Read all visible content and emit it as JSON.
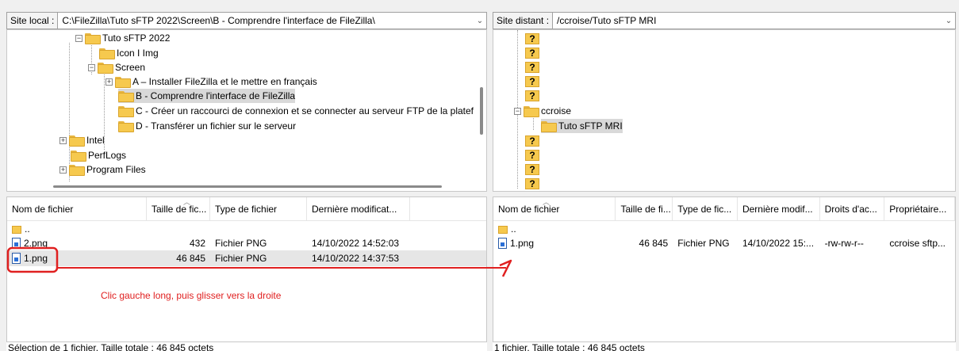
{
  "local": {
    "label": "Site local :",
    "path": "C:\\FileZilla\\Tuto sFTP 2022\\Screen\\B - Comprendre l'interface de FileZilla\\",
    "tree": [
      {
        "label": "Tuto sFTP 2022"
      },
      {
        "label": "Icon I Img"
      },
      {
        "label": "Screen"
      },
      {
        "label": "A – Installer FileZilla et le mettre en français"
      },
      {
        "label": "B - Comprendre l'interface de FileZilla"
      },
      {
        "label": "C - Créer un raccourci de connexion et se connecter au serveur FTP de la platef"
      },
      {
        "label": "D - Transférer un fichier sur le serveur"
      },
      {
        "label": "Intel"
      },
      {
        "label": "PerfLogs"
      },
      {
        "label": "Program Files"
      }
    ],
    "columns": [
      "Nom de fichier",
      "Taille de fic...",
      "Type de fichier",
      "Dernière modificat..."
    ],
    "files": [
      {
        "name": "..",
        "size": "",
        "type": "",
        "modified": ""
      },
      {
        "name": "2.png",
        "size": "432",
        "type": "Fichier PNG",
        "modified": "14/10/2022 14:52:03"
      },
      {
        "name": "1.png",
        "size": "46 845",
        "type": "Fichier PNG",
        "modified": "14/10/2022 14:37:53"
      }
    ],
    "status": "Sélection de 1 fichier. Taille totale : 46 845 octets"
  },
  "remote": {
    "label": "Site distant :",
    "path": "/ccroise/Tuto sFTP MRI",
    "unknown_marker": "?",
    "tree": [
      {
        "label": "ccroise"
      },
      {
        "label": "Tuto sFTP MRI"
      }
    ],
    "columns": [
      "Nom de fichier",
      "Taille de fi...",
      "Type de fic...",
      "Dernière modif...",
      "Droits d'ac...",
      "Propriétaire..."
    ],
    "files": [
      {
        "name": "..",
        "size": "",
        "type": "",
        "modified": "",
        "perms": "",
        "owner": ""
      },
      {
        "name": "1.png",
        "size": "46 845",
        "type": "Fichier PNG",
        "modified": "14/10/2022 15:...",
        "perms": "-rw-rw-r--",
        "owner": "ccroise sftp..."
      }
    ],
    "status": "1 fichier. Taille totale : 46 845 octets"
  },
  "annotation": {
    "text": "Clic gauche long, puis glisser vers la droite",
    "color": "#e02020"
  },
  "icons": [
    "folder-icon",
    "unknown-folder-icon",
    "file-png-icon",
    "expand-icon",
    "collapse-icon",
    "dropdown-arrow-icon"
  ]
}
